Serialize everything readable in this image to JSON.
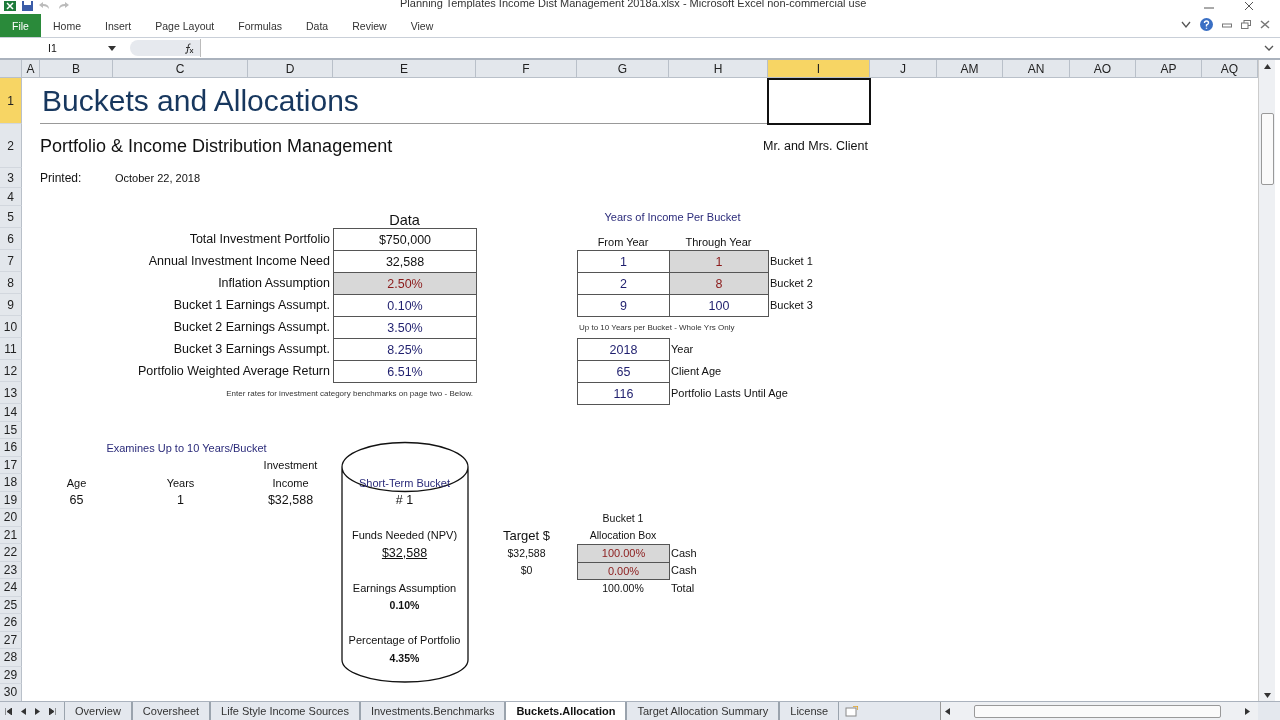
{
  "window": {
    "title": "Planning Templates Income Dist Management 2018a.xlsx - Microsoft Excel non-commercial use"
  },
  "ribbon_tabs": [
    {
      "label": "File",
      "kind": "file"
    },
    {
      "label": "Home",
      "kind": "tab"
    },
    {
      "label": "Insert",
      "kind": "tab"
    },
    {
      "label": "Page Layout",
      "kind": "tab"
    },
    {
      "label": "Formulas",
      "kind": "tab"
    },
    {
      "label": "Data",
      "kind": "tab"
    },
    {
      "label": "Review",
      "kind": "tab"
    },
    {
      "label": "View",
      "kind": "tab"
    }
  ],
  "formula_bar": {
    "name_box": "I1"
  },
  "columns": [
    {
      "label": "A",
      "selected": false
    },
    {
      "label": "B",
      "selected": false
    },
    {
      "label": "C",
      "selected": false
    },
    {
      "label": "D",
      "selected": false
    },
    {
      "label": "E",
      "selected": false
    },
    {
      "label": "F",
      "selected": false
    },
    {
      "label": "G",
      "selected": false
    },
    {
      "label": "H",
      "selected": false
    },
    {
      "label": "I",
      "selected": true
    },
    {
      "label": "J",
      "selected": false
    },
    {
      "label": "AM",
      "selected": false
    },
    {
      "label": "AN",
      "selected": false
    },
    {
      "label": "AO",
      "selected": false
    },
    {
      "label": "AP",
      "selected": false
    },
    {
      "label": "AQ",
      "selected": false
    }
  ],
  "rows": [
    {
      "label": "1",
      "selected": true
    },
    {
      "label": "2",
      "selected": false
    },
    {
      "label": "3",
      "selected": false
    },
    {
      "label": "4",
      "selected": false
    },
    {
      "label": "5",
      "selected": false
    },
    {
      "label": "6",
      "selected": false
    },
    {
      "label": "7",
      "selected": false
    },
    {
      "label": "8",
      "selected": false
    },
    {
      "label": "9",
      "selected": false
    },
    {
      "label": "10",
      "selected": false
    },
    {
      "label": "11",
      "selected": false
    },
    {
      "label": "12",
      "selected": false
    },
    {
      "label": "13",
      "selected": false
    },
    {
      "label": "14",
      "selected": false
    },
    {
      "label": "15",
      "selected": false
    },
    {
      "label": "16",
      "selected": false
    },
    {
      "label": "17",
      "selected": false
    },
    {
      "label": "18",
      "selected": false
    },
    {
      "label": "19",
      "selected": false
    },
    {
      "label": "20",
      "selected": false
    },
    {
      "label": "21",
      "selected": false
    },
    {
      "label": "22",
      "selected": false
    },
    {
      "label": "23",
      "selected": false
    },
    {
      "label": "24",
      "selected": false
    },
    {
      "label": "25",
      "selected": false
    },
    {
      "label": "26",
      "selected": false
    },
    {
      "label": "27",
      "selected": false
    },
    {
      "label": "28",
      "selected": false
    },
    {
      "label": "29",
      "selected": false
    },
    {
      "label": "30",
      "selected": false
    }
  ],
  "sheet": {
    "title": "Buckets and Allocations",
    "subtitle": "Portfolio & Income Distribution Management",
    "client": "Mr. and Mrs. Client",
    "printed_label": "Printed:",
    "printed_date": "October 22, 2018",
    "data_table": {
      "heading": "Data",
      "rows": [
        {
          "label": "Total Investment Portfolio",
          "value": "$750,000",
          "kind": "plain"
        },
        {
          "label": "Annual Investment Income Need",
          "value": "32,588",
          "kind": "plain"
        },
        {
          "label": "Inflation Assumption",
          "value": "2.50%",
          "kind": "input"
        },
        {
          "label": "Bucket 1 Earnings Assumpt.",
          "value": "0.10%",
          "kind": "calc"
        },
        {
          "label": "Bucket 2 Earnings Assumpt.",
          "value": "3.50%",
          "kind": "calc"
        },
        {
          "label": "Bucket 3 Earnings Assumpt.",
          "value": "8.25%",
          "kind": "calc"
        },
        {
          "label": "Portfolio Weighted Average Return",
          "value": "6.51%",
          "kind": "calc"
        }
      ],
      "note": "Enter rates for investment category benchmarks on page two - Below."
    },
    "years_table": {
      "heading": "Years of Income Per Bucket",
      "from_header": "From Year",
      "through_header": "Through Year",
      "rows": [
        {
          "from": "1",
          "through": {
            "value": "1",
            "kind": "input"
          },
          "label": "Bucket 1"
        },
        {
          "from": "2",
          "through": {
            "value": "8",
            "kind": "input"
          },
          "label": "Bucket 2"
        },
        {
          "from": "9",
          "through": {
            "value": "100",
            "kind": "calc"
          },
          "label": "Bucket 3"
        }
      ],
      "note": "Up to 10 Years per Bucket - Whole Yrs Only"
    },
    "info_rows": [
      {
        "value": "2018",
        "label": "Year"
      },
      {
        "value": "65",
        "label": "Client Age"
      },
      {
        "value": "116",
        "label": "Portfolio Lasts Until Age"
      }
    ],
    "bucket": {
      "note": "Examines Up to 10 Years/Bucket",
      "age_header": "Age",
      "years_header": "Years",
      "income_header": [
        "Investment",
        "Income"
      ],
      "age": "65",
      "years": "1",
      "income": "$32,588"
    },
    "cylinder": {
      "title": "Short-Term Bucket",
      "number": "# 1",
      "funds_label": "Funds Needed (NPV)",
      "funds_value": "$32,588",
      "earnings_label": "Earnings Assumption",
      "earnings_value": "0.10%",
      "share_label": "Percentage of Portfolio",
      "share_value": "4.35%"
    },
    "target": {
      "heading": "Target $",
      "values": [
        "$32,588",
        "$0"
      ]
    },
    "allocation": {
      "heading": [
        "Bucket 1",
        "Allocation Box"
      ],
      "rows": [
        {
          "pct": "100.00%",
          "label": "Cash",
          "kind": "input"
        },
        {
          "pct": "0.00%",
          "label": "Cash",
          "kind": "input"
        }
      ],
      "total": {
        "pct": "100.00%",
        "label": "Total"
      }
    }
  },
  "sheet_tabs": [
    {
      "label": "Overview",
      "selected": false
    },
    {
      "label": "Coversheet",
      "selected": false
    },
    {
      "label": "Life Style Income Sources",
      "selected": false
    },
    {
      "label": "Investments.Benchmarks",
      "selected": false
    },
    {
      "label": "Buckets.Allocation",
      "selected": true
    },
    {
      "label": "Target Allocation Summary",
      "selected": false
    },
    {
      "label": "License",
      "selected": false
    }
  ]
}
